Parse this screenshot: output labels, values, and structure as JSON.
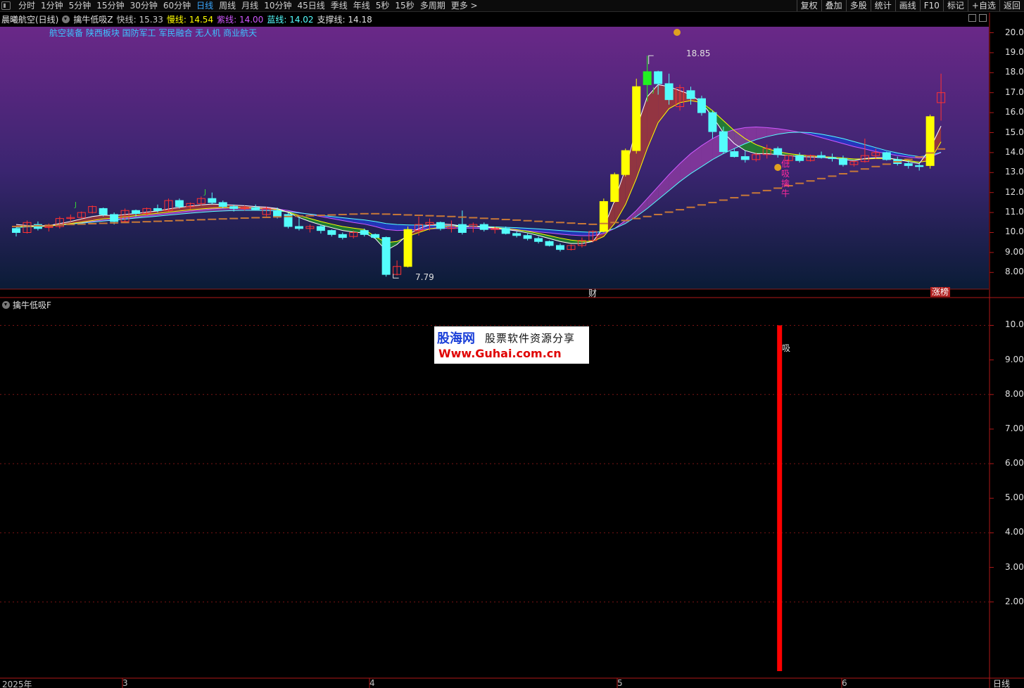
{
  "toolbar": {
    "periods": [
      "分时",
      "1分钟",
      "5分钟",
      "15分钟",
      "30分钟",
      "60分钟",
      "日线",
      "周线",
      "月线",
      "10分钟",
      "45日线",
      "季线",
      "年线",
      "5秒",
      "15秒",
      "多周期",
      "更多 >"
    ],
    "active_period": "日线",
    "tools": [
      "复权",
      "叠加",
      "多股",
      "统计",
      "画线",
      "F10",
      "标记",
      "+自选",
      "返回"
    ]
  },
  "info": {
    "stock": "晨曦航空(日线)",
    "indicator": "擒牛低吸Z",
    "lines": [
      {
        "label": "快线:",
        "value": "15.33",
        "color": "#ffffff"
      },
      {
        "label": "慢线:",
        "value": "14.54",
        "color": "#ffff00"
      },
      {
        "label": "紫线:",
        "value": "14.00",
        "color": "#d058ff"
      },
      {
        "label": "蓝线:",
        "value": "14.02",
        "color": "#55ffff"
      },
      {
        "label": "支撑线:",
        "value": "14.18",
        "color": "#e0e0e0"
      }
    ]
  },
  "plates": "航空装备 陕西板块 国防军工 军民融合 无人机 商业航天",
  "sub": {
    "title": "擒牛低吸F"
  },
  "markers": {
    "high": "18.85",
    "low": "7.79",
    "cai": "财",
    "zhangbang": "涨榜",
    "buy_text": "低吸擒牛",
    "xi": "吸",
    "j": "J"
  },
  "dates": {
    "year": "2025年",
    "m3": "3",
    "m4": "4",
    "m5": "5",
    "m6": "6"
  },
  "period_label": "日线",
  "watermark": {
    "site": "股海网",
    "tagline": "股票软件资源分享",
    "url": "Www.Guhai.com.cn"
  },
  "colors": {
    "up": "#ff3232",
    "down": "#54fcfc",
    "limit_up": "#ffff00",
    "buy_bar": "#ff0000",
    "support": "#c87838"
  },
  "chart_data": [
    {
      "type": "candlestick",
      "title": "晨曦航空(日线)",
      "ylim": [
        7.2,
        20.3
      ],
      "yticks": [
        8,
        9,
        10,
        11,
        12,
        13,
        14,
        15,
        16,
        17,
        18,
        19,
        20
      ],
      "ohlc": [
        [
          10.2,
          10.25,
          9.8,
          10.0
        ],
        [
          10.0,
          10.6,
          9.95,
          10.5
        ],
        [
          10.4,
          10.55,
          10.1,
          10.2
        ],
        [
          10.25,
          10.45,
          10.05,
          10.3
        ],
        [
          10.3,
          10.8,
          10.2,
          10.7
        ],
        [
          10.7,
          10.9,
          10.55,
          10.75
        ],
        [
          10.75,
          11.05,
          10.7,
          11.0
        ],
        [
          11.0,
          11.35,
          10.95,
          11.3
        ],
        [
          11.2,
          11.25,
          10.8,
          10.9
        ],
        [
          10.9,
          11.0,
          10.4,
          10.55
        ],
        [
          10.55,
          11.2,
          10.5,
          11.1
        ],
        [
          11.1,
          11.15,
          10.8,
          10.95
        ],
        [
          10.95,
          11.25,
          10.85,
          11.2
        ],
        [
          11.2,
          11.4,
          11.0,
          11.1
        ],
        [
          11.1,
          11.7,
          11.05,
          11.6
        ],
        [
          11.6,
          11.7,
          11.2,
          11.3
        ],
        [
          11.3,
          11.5,
          11.15,
          11.45
        ],
        [
          11.45,
          11.8,
          11.35,
          11.7
        ],
        [
          11.7,
          12.0,
          11.4,
          11.5
        ],
        [
          11.5,
          11.6,
          11.2,
          11.3
        ],
        [
          11.3,
          11.4,
          11.05,
          11.2
        ],
        [
          11.2,
          11.35,
          11.1,
          11.25
        ],
        [
          11.25,
          11.4,
          11.1,
          11.15
        ],
        [
          10.9,
          11.3,
          10.8,
          11.2
        ],
        [
          11.1,
          11.25,
          10.7,
          10.8
        ],
        [
          10.9,
          11.0,
          10.2,
          10.3
        ],
        [
          10.3,
          10.8,
          10.1,
          10.2
        ],
        [
          10.2,
          10.4,
          10.0,
          10.3
        ],
        [
          10.3,
          10.4,
          9.95,
          10.1
        ],
        [
          10.1,
          10.15,
          9.8,
          9.9
        ],
        [
          9.9,
          10.0,
          9.65,
          9.75
        ],
        [
          9.8,
          10.1,
          9.7,
          10.0
        ],
        [
          10.1,
          10.2,
          9.8,
          9.9
        ],
        [
          9.9,
          9.95,
          9.7,
          9.75
        ],
        [
          9.75,
          9.8,
          7.79,
          7.9
        ],
        [
          7.9,
          8.6,
          7.85,
          8.3
        ],
        [
          8.3,
          10.3,
          8.25,
          10.15
        ],
        [
          10.1,
          10.8,
          9.85,
          10.4
        ],
        [
          10.4,
          10.7,
          10.1,
          10.5
        ],
        [
          10.5,
          10.55,
          10.1,
          10.2
        ],
        [
          10.2,
          10.6,
          10.0,
          10.3
        ],
        [
          10.4,
          11.1,
          9.9,
          10.0
        ],
        [
          10.3,
          10.5,
          10.0,
          10.4
        ],
        [
          10.4,
          10.5,
          10.05,
          10.15
        ],
        [
          10.15,
          10.3,
          9.95,
          10.2
        ],
        [
          10.2,
          10.3,
          9.9,
          9.95
        ],
        [
          9.95,
          10.05,
          9.75,
          9.85
        ],
        [
          9.85,
          9.95,
          9.6,
          9.7
        ],
        [
          9.7,
          9.8,
          9.45,
          9.55
        ],
        [
          9.55,
          9.6,
          9.3,
          9.35
        ],
        [
          9.35,
          9.45,
          9.05,
          9.15
        ],
        [
          9.15,
          9.4,
          9.1,
          9.35
        ],
        [
          9.35,
          9.75,
          9.25,
          9.6
        ],
        [
          9.6,
          10.1,
          9.5,
          10.05
        ],
        [
          10.05,
          11.7,
          10.0,
          11.55
        ],
        [
          11.55,
          13.0,
          11.5,
          12.9
        ],
        [
          12.9,
          14.2,
          12.8,
          14.1
        ],
        [
          14.1,
          17.7,
          13.95,
          17.3
        ],
        [
          17.4,
          18.85,
          16.55,
          18.05
        ],
        [
          18.05,
          18.1,
          16.9,
          17.45
        ],
        [
          17.45,
          17.95,
          16.4,
          16.65
        ],
        [
          16.3,
          17.4,
          16.1,
          17.25
        ],
        [
          17.1,
          17.3,
          16.4,
          16.7
        ],
        [
          16.7,
          16.85,
          15.85,
          16.0
        ],
        [
          16.0,
          16.1,
          14.7,
          15.05
        ],
        [
          15.05,
          15.3,
          13.95,
          14.05
        ],
        [
          14.05,
          14.2,
          13.75,
          13.8
        ],
        [
          13.8,
          14.1,
          13.5,
          13.65
        ],
        [
          13.65,
          14.0,
          13.55,
          13.9
        ],
        [
          13.9,
          14.4,
          13.7,
          14.2
        ],
        [
          14.2,
          14.3,
          13.75,
          13.9
        ],
        [
          13.6,
          13.9,
          13.4,
          13.85
        ],
        [
          13.85,
          14.0,
          13.5,
          13.6
        ],
        [
          13.6,
          13.9,
          13.55,
          13.85
        ],
        [
          13.85,
          14.05,
          13.7,
          13.75
        ],
        [
          13.75,
          13.95,
          13.55,
          13.7
        ],
        [
          13.7,
          13.85,
          13.3,
          13.4
        ],
        [
          13.4,
          13.6,
          13.3,
          13.55
        ],
        [
          13.55,
          14.7,
          13.5,
          13.85
        ],
        [
          13.85,
          14.2,
          13.7,
          14.0
        ],
        [
          14.0,
          14.05,
          13.6,
          13.65
        ],
        [
          13.65,
          13.8,
          13.35,
          13.45
        ],
        [
          13.45,
          13.6,
          13.2,
          13.35
        ],
        [
          13.35,
          13.45,
          13.1,
          13.3
        ],
        [
          13.35,
          15.9,
          13.2,
          15.8
        ],
        [
          16.5,
          17.95,
          15.6,
          17.0
        ]
      ],
      "series": [
        {
          "name": "快线",
          "values": [
            10.4,
            10.35,
            10.32,
            10.35,
            10.45,
            10.55,
            10.68,
            10.8,
            10.87,
            10.84,
            10.9,
            10.95,
            11.02,
            11.08,
            11.18,
            11.26,
            11.32,
            11.38,
            11.42,
            11.4,
            11.37,
            11.34,
            11.3,
            11.27,
            11.2,
            11.0,
            10.75,
            10.55,
            10.38,
            10.24,
            10.1,
            10.02,
            9.98,
            9.7,
            9.1,
            9.4,
            9.9,
            10.2,
            10.38,
            10.42,
            10.4,
            10.32,
            10.3,
            10.28,
            10.22,
            10.15,
            10.08,
            9.98,
            9.85,
            9.7,
            9.55,
            9.45,
            9.45,
            9.55,
            10.25,
            11.6,
            13.2,
            15.2,
            16.8,
            17.4,
            17.3,
            17.1,
            16.9,
            16.5,
            15.8,
            15.0,
            14.45,
            14.1,
            13.95,
            13.95,
            13.9,
            13.85,
            13.8,
            13.78,
            13.76,
            13.72,
            13.66,
            13.6,
            13.7,
            13.75,
            13.74,
            13.65,
            13.55,
            13.45,
            14.2,
            15.33
          ]
        },
        {
          "name": "慢线",
          "values": [
            10.3,
            10.3,
            10.3,
            10.32,
            10.38,
            10.45,
            10.52,
            10.6,
            10.68,
            10.72,
            10.78,
            10.84,
            10.9,
            10.96,
            11.02,
            11.08,
            11.13,
            11.18,
            11.22,
            11.24,
            11.25,
            11.24,
            11.22,
            11.2,
            11.15,
            11.02,
            10.85,
            10.7,
            10.55,
            10.42,
            10.3,
            10.22,
            10.15,
            9.8,
            9.5,
            9.55,
            9.8,
            10.0,
            10.18,
            10.26,
            10.3,
            10.3,
            10.3,
            10.28,
            10.24,
            10.2,
            10.14,
            10.06,
            9.96,
            9.84,
            9.72,
            9.62,
            9.56,
            9.56,
            9.8,
            10.45,
            11.4,
            12.7,
            14.2,
            15.5,
            16.2,
            16.5,
            16.6,
            16.5,
            16.1,
            15.6,
            15.1,
            14.7,
            14.4,
            14.2,
            14.05,
            13.95,
            13.88,
            13.84,
            13.8,
            13.77,
            13.73,
            13.68,
            13.68,
            13.7,
            13.7,
            13.66,
            13.6,
            13.52,
            13.6,
            14.54
          ]
        },
        {
          "name": "紫线",
          "values": [
            10.3,
            10.3,
            10.32,
            10.35,
            10.4,
            10.45,
            10.5,
            10.56,
            10.62,
            10.66,
            10.72,
            10.78,
            10.84,
            10.9,
            10.96,
            11.02,
            11.08,
            11.13,
            11.18,
            11.22,
            11.25,
            11.25,
            11.24,
            11.22,
            11.18,
            11.1,
            11.0,
            10.9,
            10.8,
            10.7,
            10.6,
            10.5,
            10.42,
            10.3,
            10.15,
            10.1,
            10.12,
            10.15,
            10.18,
            10.2,
            10.22,
            10.22,
            10.22,
            10.2,
            10.18,
            10.15,
            10.12,
            10.08,
            10.03,
            9.98,
            9.92,
            9.87,
            9.84,
            9.84,
            9.95,
            10.2,
            10.6,
            11.1,
            11.7,
            12.3,
            12.9,
            13.45,
            13.95,
            14.35,
            14.7,
            14.98,
            15.15,
            15.25,
            15.28,
            15.25,
            15.2,
            15.12,
            15.02,
            14.9,
            14.75,
            14.6,
            14.45,
            14.3,
            14.18,
            14.05,
            13.95,
            13.85,
            13.78,
            13.72,
            13.78,
            14.0
          ]
        },
        {
          "name": "蓝线",
          "values": [
            10.25,
            10.28,
            10.3,
            10.33,
            10.37,
            10.42,
            10.47,
            10.52,
            10.57,
            10.62,
            10.67,
            10.72,
            10.77,
            10.82,
            10.87,
            10.92,
            10.97,
            11.01,
            11.05,
            11.08,
            11.1,
            11.11,
            11.11,
            11.1,
            11.08,
            11.04,
            10.98,
            10.92,
            10.86,
            10.8,
            10.74,
            10.68,
            10.63,
            10.55,
            10.45,
            10.4,
            10.38,
            10.37,
            10.36,
            10.35,
            10.34,
            10.33,
            10.32,
            10.3,
            10.28,
            10.26,
            10.24,
            10.21,
            10.18,
            10.14,
            10.1,
            10.06,
            10.03,
            10.01,
            10.05,
            10.2,
            10.45,
            10.8,
            11.2,
            11.65,
            12.1,
            12.55,
            12.95,
            13.3,
            13.65,
            13.95,
            14.2,
            14.45,
            14.65,
            14.8,
            14.92,
            15.0,
            15.02,
            15.0,
            14.92,
            14.82,
            14.7,
            14.55,
            14.4,
            14.25,
            14.1,
            13.98,
            13.88,
            13.8,
            13.85,
            14.02
          ]
        },
        {
          "name": "支撑线",
          "values": [
            10.3,
            10.32,
            10.34,
            10.36,
            10.38,
            10.4,
            10.42,
            10.44,
            10.46,
            10.48,
            10.5,
            10.52,
            10.54,
            10.56,
            10.58,
            10.6,
            10.62,
            10.64,
            10.66,
            10.68,
            10.7,
            10.72,
            10.74,
            10.76,
            10.78,
            10.8,
            10.82,
            10.84,
            10.86,
            10.88,
            10.9,
            10.92,
            10.94,
            10.94,
            10.92,
            10.9,
            10.88,
            10.86,
            10.84,
            10.82,
            10.8,
            10.77,
            10.74,
            10.71,
            10.68,
            10.65,
            10.62,
            10.59,
            10.56,
            10.53,
            10.5,
            10.47,
            10.44,
            10.41,
            10.45,
            10.5,
            10.6,
            10.7,
            10.8,
            10.9,
            11.02,
            11.14,
            11.26,
            11.38,
            11.5,
            11.62,
            11.74,
            11.86,
            11.98,
            12.1,
            12.22,
            12.34,
            12.46,
            12.58,
            12.7,
            12.82,
            12.94,
            13.06,
            13.18,
            13.3,
            13.42,
            13.54,
            13.66,
            13.78,
            13.98,
            14.18
          ]
        }
      ]
    },
    {
      "type": "bar",
      "title": "擒牛低吸F",
      "ylim": [
        0,
        10.6
      ],
      "yticks": [
        2,
        3,
        4,
        5,
        6,
        7,
        8,
        9,
        10
      ],
      "buy_signal_index": 70,
      "value": 10
    }
  ]
}
